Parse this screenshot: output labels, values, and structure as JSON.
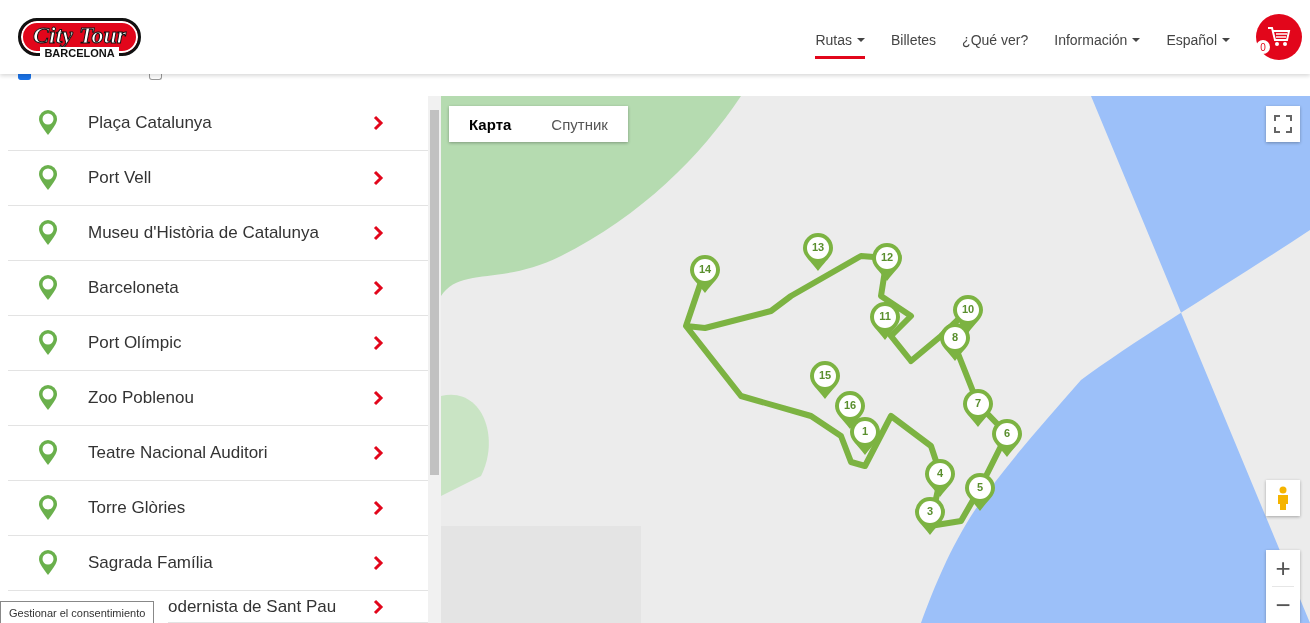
{
  "header": {
    "logo": {
      "title": "City Tour",
      "subtitle": "BARCELONA"
    },
    "nav": [
      {
        "label": "Rutas",
        "dropdown": true,
        "selected": true
      },
      {
        "label": "Billetes",
        "dropdown": false,
        "selected": false
      },
      {
        "label": "¿Qué ver?",
        "dropdown": false,
        "selected": false
      },
      {
        "label": "Información",
        "dropdown": true,
        "selected": false
      },
      {
        "label": "Español",
        "dropdown": true,
        "selected": false
      }
    ],
    "cart": {
      "count": "0"
    }
  },
  "route_filters": [
    {
      "checked": true
    },
    {
      "checked": false
    }
  ],
  "stops": [
    {
      "name": "Plaça Catalunya",
      "kind": "full"
    },
    {
      "name": "Port Vell",
      "kind": "full"
    },
    {
      "name": "Museu d'Història de Catalunya",
      "kind": "full"
    },
    {
      "name": "Barceloneta",
      "kind": "full"
    },
    {
      "name": "Port Olímpic",
      "kind": "full"
    },
    {
      "name": "Zoo Poblenou",
      "kind": "full"
    },
    {
      "name": "Teatre Nacional Auditori",
      "kind": "full"
    },
    {
      "name": "Torre Glòries",
      "kind": "full"
    },
    {
      "name": "Sagrada Família",
      "kind": "full"
    },
    {
      "name": "odernista de Sant Pau",
      "kind": "covered"
    }
  ],
  "consent_button": "Gestionar el consentimiento",
  "map": {
    "map_types": [
      {
        "label": "Карта",
        "selected": true
      },
      {
        "label": "Спутник",
        "selected": false
      }
    ],
    "markers": [
      {
        "label": "1"
      },
      {
        "label": "3"
      },
      {
        "label": "4"
      },
      {
        "label": "5"
      },
      {
        "label": "6"
      },
      {
        "label": "7"
      },
      {
        "label": "8"
      },
      {
        "label": "10"
      },
      {
        "label": "11"
      },
      {
        "label": "12"
      },
      {
        "label": "13"
      },
      {
        "label": "14"
      },
      {
        "label": "15"
      },
      {
        "label": "16"
      }
    ],
    "zoom_in": "+",
    "zoom_out": "−"
  }
}
